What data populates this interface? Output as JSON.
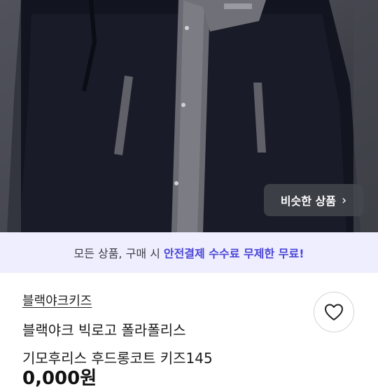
{
  "product_image": {
    "alt_icon": "coat-photo"
  },
  "similar_button": {
    "label": "비슷한 상품",
    "chevron": "›"
  },
  "banner": {
    "text_prefix": "모든 상품, 구매 시",
    "text_highlight": "안전결제 수수료 무제한 무료!"
  },
  "store": {
    "name": "블랙야크키즈"
  },
  "product": {
    "title_line1": "블랙야크 빅로고 폴라폴리스",
    "title_line2": "기모후리스 후드롱코트 키즈145",
    "price": "0,000원"
  },
  "colors": {
    "accent": "#4a45d6",
    "banner_bg": "#eeeefe"
  },
  "icons": {
    "like": "heart-icon"
  }
}
